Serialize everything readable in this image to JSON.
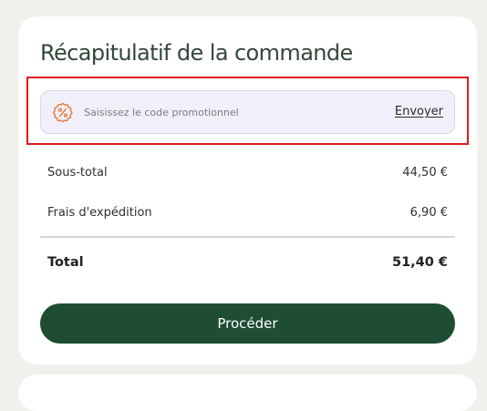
{
  "summary": {
    "title": "Récapitulatif de la commande"
  },
  "promo": {
    "icon": "percent-badge-icon",
    "placeholder": "Saisissez le code promotionnel",
    "submit_label": "Envoyer",
    "accent_color": "#e8763a"
  },
  "totals": {
    "subtotal_label": "Sous-total",
    "subtotal_value": "44,50 €",
    "shipping_label": "Frais d'expédition",
    "shipping_value": "6,90 €",
    "total_label": "Total",
    "total_value": "51,40 €"
  },
  "actions": {
    "proceed_label": "Procéder",
    "proceed_color": "#1e4d34"
  },
  "highlight": {
    "color": "#e01b1b"
  }
}
